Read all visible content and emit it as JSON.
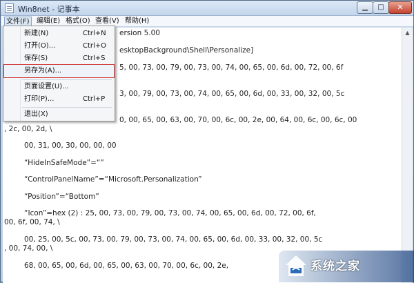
{
  "window": {
    "title": "Win8net - 记事本",
    "controls": {
      "minimize": "▁",
      "maximize": "□",
      "close": "✕"
    }
  },
  "menubar": {
    "items": [
      {
        "label": "文件(F)",
        "active": true
      },
      {
        "label": "编辑(E)"
      },
      {
        "label": "格式(O)"
      },
      {
        "label": "查看(V)"
      },
      {
        "label": "帮助(H)"
      }
    ]
  },
  "file_menu": {
    "items": [
      {
        "label": "新建(N)",
        "shortcut": "Ctrl+N"
      },
      {
        "label": "打开(O)...",
        "shortcut": "Ctrl+O"
      },
      {
        "label": "保存(S)",
        "shortcut": "Ctrl+S"
      },
      {
        "label": "另存为(A)...",
        "shortcut": "",
        "highlighted": true
      },
      {
        "label": "页面设置(U)...",
        "shortcut": ""
      },
      {
        "label": "打印(P)...",
        "shortcut": "Ctrl+P"
      },
      {
        "label": "退出(X)",
        "shortcut": ""
      }
    ]
  },
  "editor": {
    "lines": [
      "ersion 5.00",
      "esktopBackground\\Shell\\Personalize]",
      "5, 00, 73, 00, 79, 00, 73, 00, 74, 00, 65, 00, 6d, 00, 72, 00, 6f",
      "3, 00, 79, 00, 73, 00, 74, 00, 65, 00, 6d, 00, 33, 00, 32, 00, 5c",
      "0, 00, 65, 00, 63, 00, 70, 00, 6c, 00, 2e, 00, 64, 00, 6c, 00, 6c, 00",
      ", 2c, 00, 2d, \\",
      "00, 31, 00, 30, 00, 00, 00",
      "“HideInSafeMode”=“”",
      "“ControlPanelName”=“Microsoft.Personalization”",
      "“Position”=“Bottom”",
      "“Icon”=hex (2) : 25, 00, 73, 00, 79, 00, 73, 00, 74, 00, 65, 00, 6d, 00, 72, 00, 6f,",
      "00, 6f, 00, 74, \\",
      "00, 25, 00, 5c, 00, 73, 00, 79, 00, 73, 00, 74, 00, 65, 00, 6d, 00, 33, 00, 32, 00, 5c",
      ", 00, 74, 00, \\",
      "68, 00, 65, 00, 6d, 00, 65, 00, 63, 00, 70, 00, 6c, 00, 2e,"
    ]
  },
  "watermark": {
    "text": "系统之家"
  },
  "colors": {
    "menu_highlight_border": "#cf3b3b",
    "title_bar": "#c4d6ec",
    "close_button": "#c4432e"
  }
}
